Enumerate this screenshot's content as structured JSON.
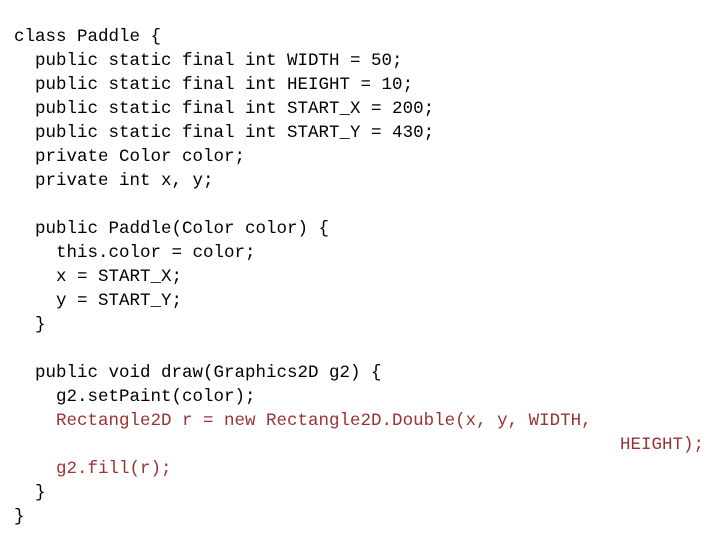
{
  "document": {
    "type": "source-code-listing",
    "language": "Java",
    "background_color": "#ffffff",
    "default_text_color": "#000000",
    "highlight_text_color": "#993333"
  },
  "code": {
    "lines": [
      {
        "text": "class Paddle {",
        "color": "black",
        "indent": 0,
        "continuation": false
      },
      {
        "text": "  public static final int WIDTH = 50;",
        "color": "black",
        "indent": 2,
        "continuation": false
      },
      {
        "text": "  public static final int HEIGHT = 10;",
        "color": "black",
        "indent": 2,
        "continuation": false
      },
      {
        "text": "  public static final int START_X = 200;",
        "color": "black",
        "indent": 2,
        "continuation": false
      },
      {
        "text": "  public static final int START_Y = 430;",
        "color": "black",
        "indent": 2,
        "continuation": false
      },
      {
        "text": "  private Color color;",
        "color": "black",
        "indent": 2,
        "continuation": false
      },
      {
        "text": "  private int x, y;",
        "color": "black",
        "indent": 2,
        "continuation": false
      },
      {
        "text": "",
        "color": "black",
        "indent": 0,
        "continuation": false
      },
      {
        "text": "  public Paddle(Color color) {",
        "color": "black",
        "indent": 2,
        "continuation": false
      },
      {
        "text": "    this.color = color;",
        "color": "black",
        "indent": 4,
        "continuation": false
      },
      {
        "text": "    x = START_X;",
        "color": "black",
        "indent": 4,
        "continuation": false
      },
      {
        "text": "    y = START_Y;",
        "color": "black",
        "indent": 4,
        "continuation": false
      },
      {
        "text": "  }",
        "color": "black",
        "indent": 2,
        "continuation": false
      },
      {
        "text": "",
        "color": "black",
        "indent": 0,
        "continuation": false
      },
      {
        "text": "  public void draw(Graphics2D g2) {",
        "color": "black",
        "indent": 2,
        "continuation": false
      },
      {
        "text": "    g2.setPaint(color);",
        "color": "black",
        "indent": 4,
        "continuation": false
      },
      {
        "text": "    Rectangle2D r = new Rectangle2D.Double(x, y, WIDTH,",
        "color": "red",
        "indent": 4,
        "continuation": false
      },
      {
        "text": "HEIGHT);",
        "color": "red",
        "indent": 0,
        "continuation": true
      },
      {
        "text": "    g2.fill(r);",
        "color": "red",
        "indent": 4,
        "continuation": false
      },
      {
        "text": "  }",
        "color": "black",
        "indent": 2,
        "continuation": false
      },
      {
        "text": "}",
        "color": "black",
        "indent": 0,
        "continuation": false
      }
    ]
  }
}
